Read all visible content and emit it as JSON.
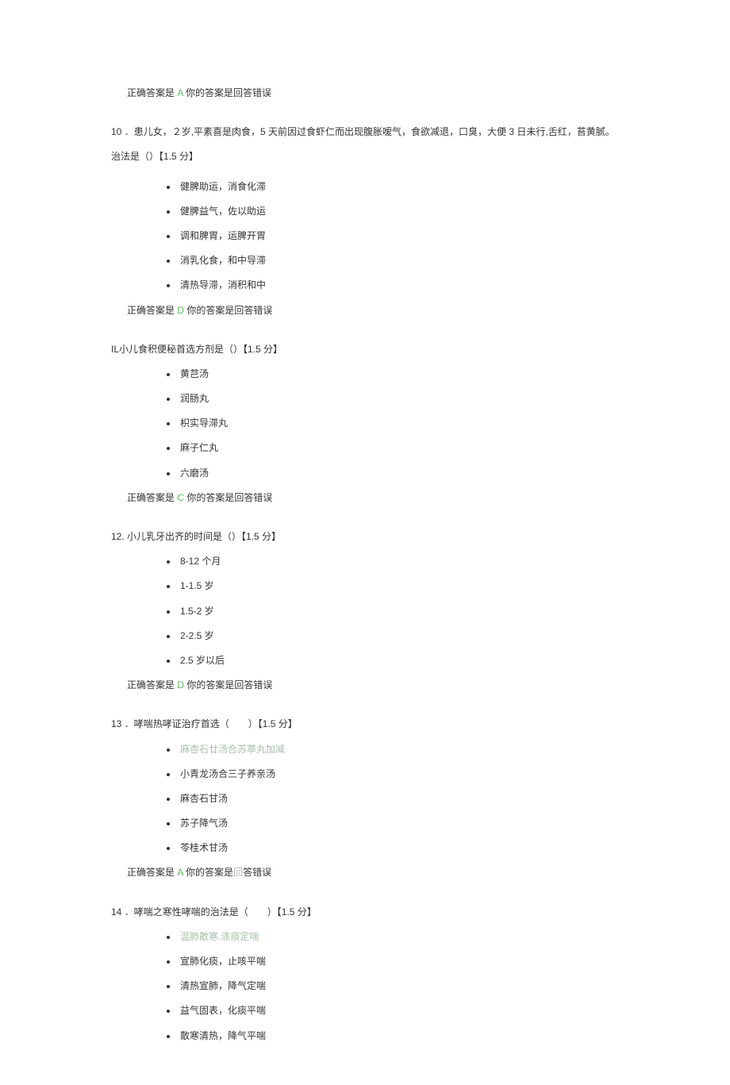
{
  "answer_prefix": "正确答案是",
  "answer_suffix_1": "你的答案是回答错误",
  "answer_suffix_faded_pre": "你的答案是",
  "answer_suffix_faded_mid": "回",
  "answer_suffix_faded_post": "答错误",
  "q9": {
    "correct": "A"
  },
  "q10": {
    "num": "10",
    "text": "．患儿女，２岁,平素喜是肉食，5 天前因过食虾仁而出现腹胀嗳气，食欲减退，口臭，大便 3 日未行,舌红，苔黄腻。",
    "sub": "治法是（）【1.5 分】",
    "opts": [
      "健脾助运，消食化滞",
      "健脾益气，佐以助运",
      "调和脾胃，运脾开胃",
      "消乳化食，和中导滞",
      "清热导滞，消积和中"
    ],
    "correct": "D"
  },
  "q11": {
    "text": "IL小儿食积便秘首选方剂是（）【1.5 分】",
    "opts": [
      "黄芑汤",
      "润肠丸",
      "枳实导滞丸",
      "麻子仁丸",
      "六磨汤"
    ],
    "correct": "C"
  },
  "q12": {
    "text": "12. 小儿乳牙出齐的时间是（）【1.5 分】",
    "opts": [
      "8-12 个月",
      "1-1.5 岁",
      "1.5-2 岁",
      "2-2.5 岁",
      "2.5 岁以后"
    ],
    "correct": "D"
  },
  "q13": {
    "num": "13",
    "text": "．哮喘热哮证治疗首选（　　）【1.5 分】",
    "opts": [
      "麻杏石廿汤合苏葶丸加减",
      "小青龙汤合三子养亲汤",
      "麻杏石甘汤",
      "苏子降气汤",
      "苓桂术甘汤"
    ],
    "correct": "A"
  },
  "q14": {
    "num": "14",
    "text": "．哮喘之寒性哮喘的治法是（　　）【1.5 分】",
    "opts": [
      "温肺散寒.涤痰定喘",
      "宣肺化痰，止咳平喘",
      "清热宣肺，降气定喘",
      "益气固表，化痰平喘",
      "散寒清热，降气平喘"
    ]
  }
}
